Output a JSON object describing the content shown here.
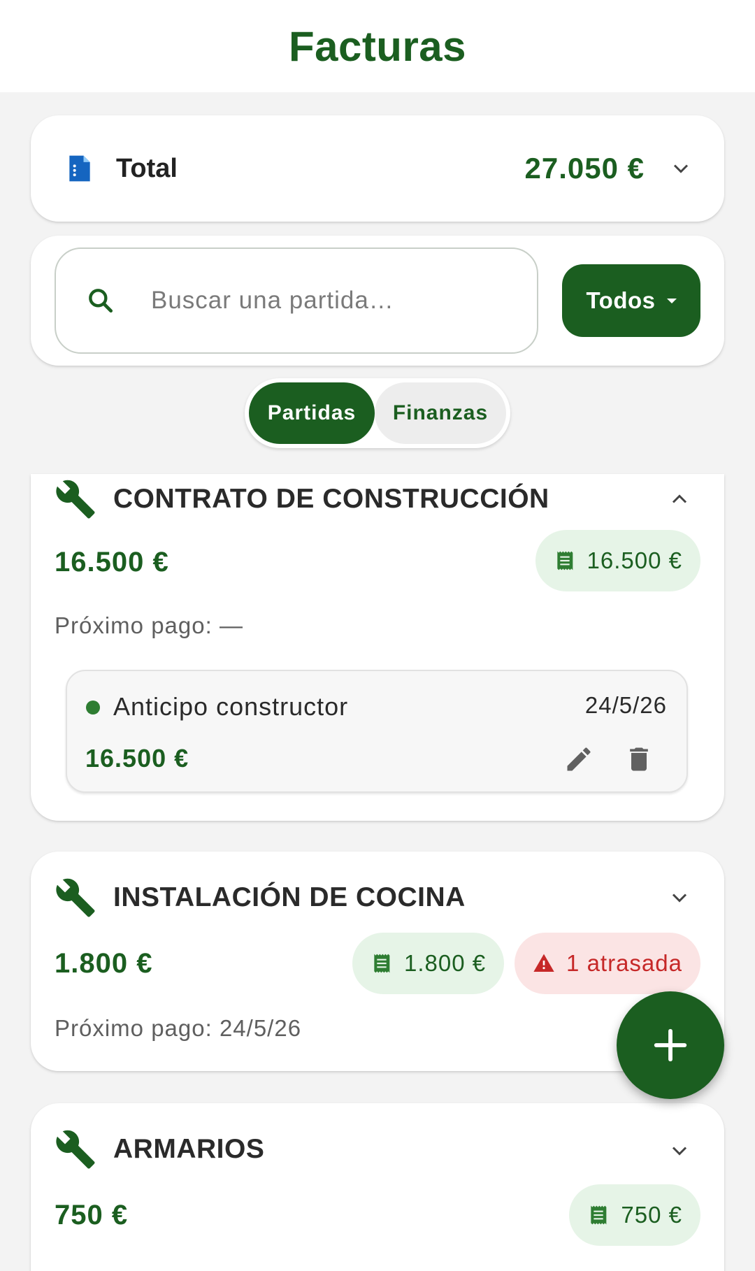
{
  "header": {
    "title": "Facturas"
  },
  "total": {
    "label": "Total",
    "amount": "27.050 €",
    "icon": "document-icon"
  },
  "search": {
    "placeholder": "Buscar una partida…",
    "filter_label": "Todos"
  },
  "tabs": [
    {
      "label": "Partidas",
      "active": true
    },
    {
      "label": "Finanzas",
      "active": false
    }
  ],
  "sections": [
    {
      "title": "CONTRATO DE CONSTRUCCIÓN",
      "amount": "16.500 €",
      "invoice_chip": "16.500 €",
      "next_payment": "Próximo pago: —",
      "expanded": true,
      "payments": [
        {
          "name": "Anticipo constructor",
          "date": "24/5/26",
          "amount": "16.500 €"
        }
      ]
    },
    {
      "title": "INSTALACIÓN DE COCINA",
      "amount": "1.800 €",
      "invoice_chip": "1.800 €",
      "overdue_chip": "1 atrasada",
      "next_payment": "Próximo pago: 24/5/26",
      "expanded": false
    },
    {
      "title": "ARMARIOS",
      "amount": "750 €",
      "invoice_chip": "750 €",
      "expanded": false
    }
  ],
  "colors": {
    "primary": "#1b5e20",
    "chip_green_bg": "#e6f4e7",
    "chip_red_bg": "#fbe4e4",
    "danger": "#c62828"
  }
}
